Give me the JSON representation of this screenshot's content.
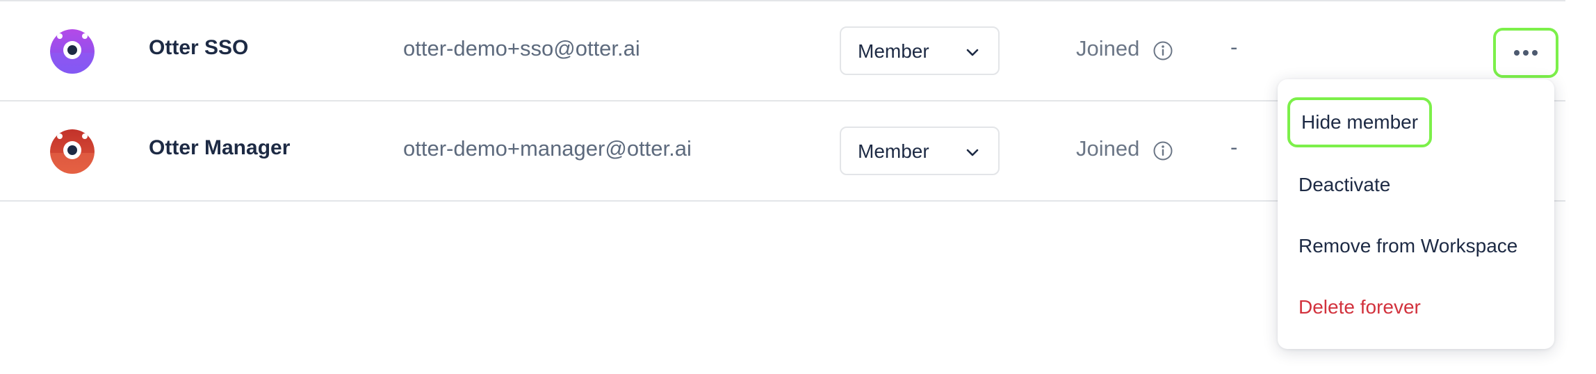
{
  "members": [
    {
      "name": "Otter SSO",
      "email": "otter-demo+sso@otter.ai",
      "role": "Member",
      "status": "Joined",
      "extra": "-",
      "avatar_color": "#8a4df2"
    },
    {
      "name": "Otter Manager",
      "email": "otter-demo+manager@otter.ai",
      "role": "Member",
      "status": "Joined",
      "extra": "-",
      "avatar_color": "#d9442b"
    }
  ],
  "menu": {
    "items": [
      {
        "label": "Hide member"
      },
      {
        "label": "Deactivate"
      },
      {
        "label": "Remove from Workspace"
      },
      {
        "label": "Delete forever"
      }
    ]
  },
  "colors": {
    "highlight": "#7cf04a",
    "danger": "#d2323d",
    "text_primary": "#1d2a44",
    "text_secondary": "#5d6a7d"
  },
  "icons": {
    "more": "more-horizontal-icon",
    "info": "info-icon",
    "chevron": "chevron-down-icon"
  }
}
